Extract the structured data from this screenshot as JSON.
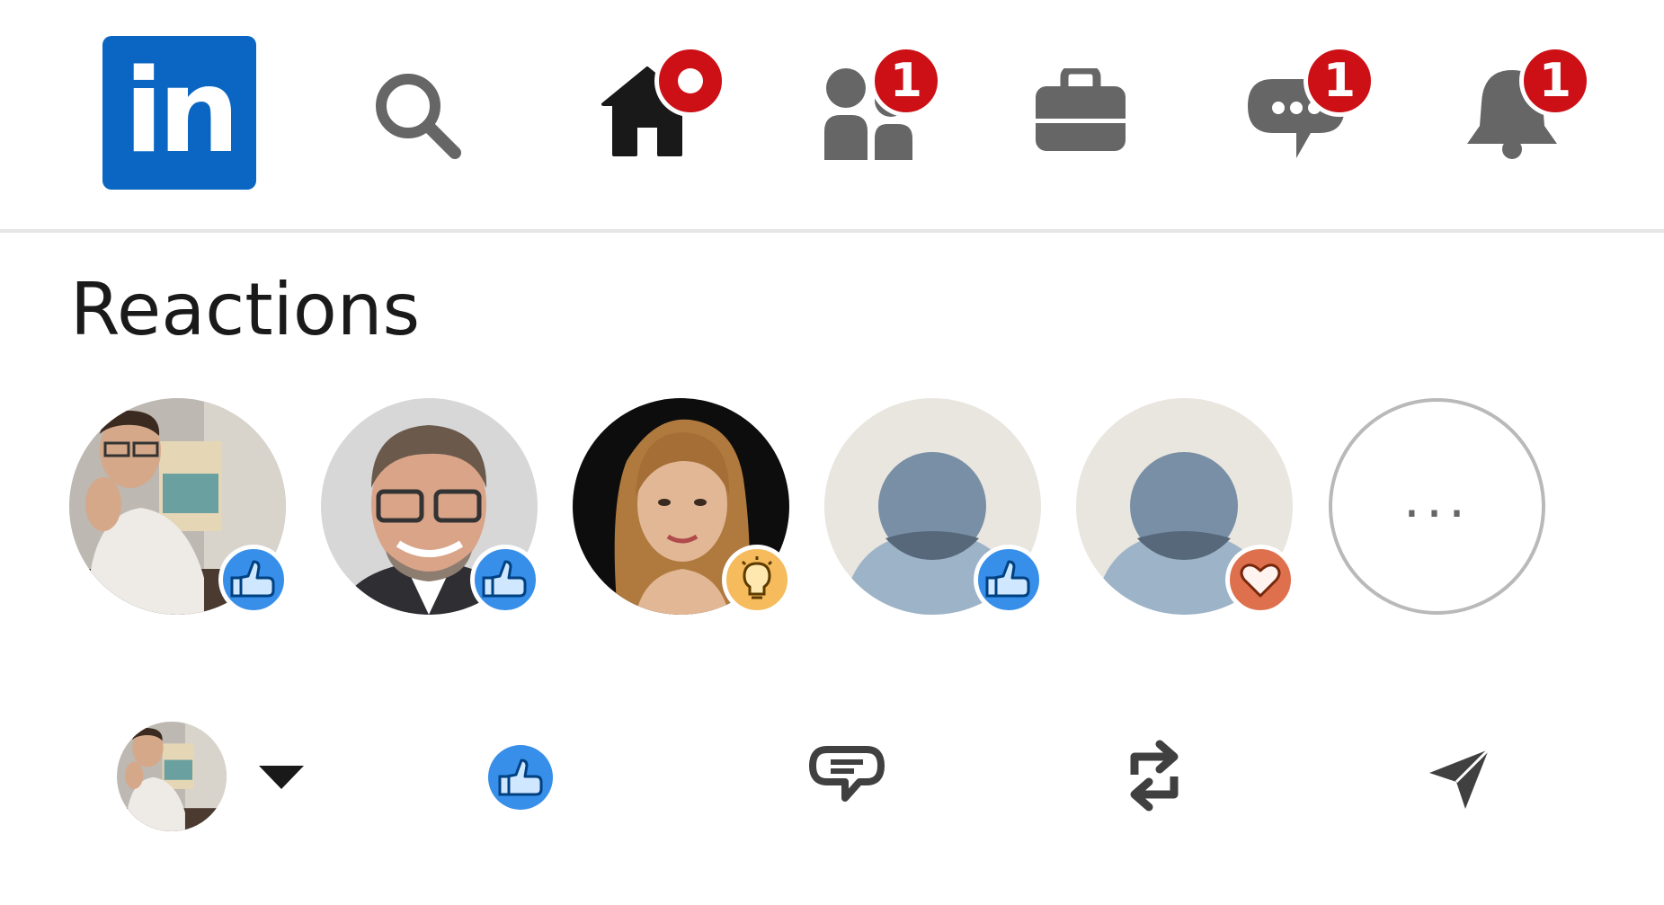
{
  "nav": {
    "logo_text": "in",
    "items": [
      {
        "id": "search",
        "icon": "search-icon"
      },
      {
        "id": "home",
        "icon": "home-icon",
        "badge": "dot",
        "active": true
      },
      {
        "id": "my-network",
        "icon": "people-icon",
        "badge": "1"
      },
      {
        "id": "jobs",
        "icon": "briefcase-icon"
      },
      {
        "id": "messaging",
        "icon": "chat-icon",
        "badge": "1"
      },
      {
        "id": "notifications",
        "icon": "bell-icon",
        "badge": "1"
      }
    ]
  },
  "reactions": {
    "title": "Reactions",
    "people": [
      {
        "avatar": "photo",
        "reaction": "like"
      },
      {
        "avatar": "photo",
        "reaction": "like"
      },
      {
        "avatar": "photo",
        "reaction": "insightful"
      },
      {
        "avatar": "placeholder",
        "reaction": "like"
      },
      {
        "avatar": "placeholder",
        "reaction": "love"
      }
    ],
    "more_label": "..."
  },
  "actions": [
    {
      "id": "current-user",
      "icon": "avatar-with-dropdown"
    },
    {
      "id": "like",
      "icon": "like-icon"
    },
    {
      "id": "comment",
      "icon": "comment-icon"
    },
    {
      "id": "repost",
      "icon": "repost-icon"
    },
    {
      "id": "send",
      "icon": "send-icon"
    }
  ],
  "colors": {
    "brand": "#0a66c2",
    "badge": "#cc1016",
    "nav_icon": "#666666",
    "nav_icon_active": "#191919",
    "like": "#378fe9",
    "insightful": "#f5bb5c",
    "love": "#df704d"
  }
}
